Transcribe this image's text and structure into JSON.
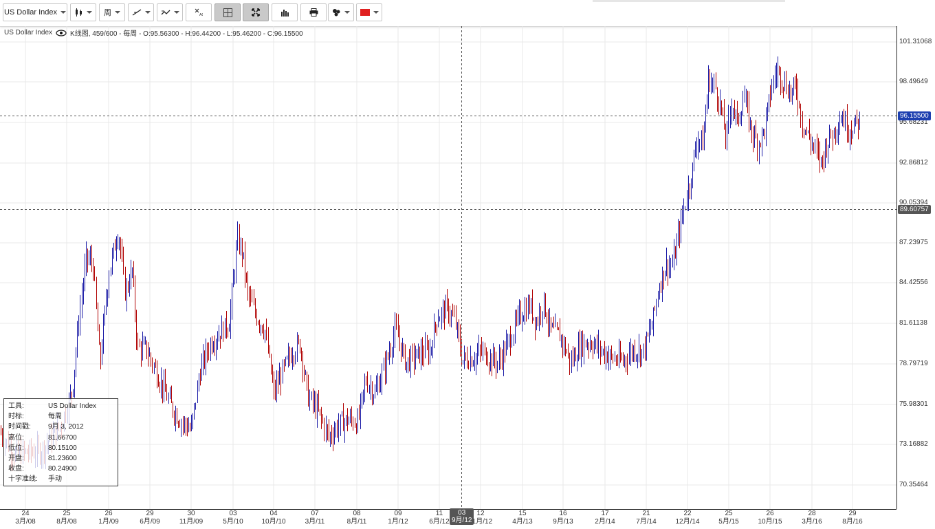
{
  "toolbar": {
    "symbol_select": {
      "value": "US Dollar Index",
      "icon": "chevron-down-icon"
    },
    "chart_style_icon": "candlestick-icon",
    "period_select": {
      "value": "周"
    },
    "indicator_icon": "trend-line-icon",
    "compare_icon": "compare-icon",
    "crosshair_icon": "crosshair-cursor-icon",
    "grid_icon": "grid-toggle-icon",
    "fit_icon": "fit-screen-icon",
    "volume_icon": "volume-bars-icon",
    "print_icon": "print-icon",
    "tools_icon": "drawing-tools-icon",
    "color_icon": "color-swatch-icon",
    "color_swatch": "#e02020"
  },
  "legend": {
    "symbol": "US Dollar Index",
    "eye_icon": "eye-icon",
    "details": "K线图, 459/600 - 每周 - O:95.56300 - H:96.44200 - L:95.46200 - C:96.15500"
  },
  "price_axis": {
    "ticks": [
      "101.31068",
      "98.49649",
      "95.68231",
      "92.86812",
      "90.05394",
      "87.23975",
      "84.42556",
      "81.61138",
      "78.79719",
      "75.98301",
      "73.16882",
      "70.35464"
    ],
    "last_price_tag": "96.15500",
    "crosshair_price_tag": "89.60757",
    "last_price_color": "#1c3fb0",
    "crosshair_tag_color": "#555555"
  },
  "time_axis": {
    "labels": [
      {
        "day": "24",
        "month": "3月/08"
      },
      {
        "day": "25",
        "month": "8月/08"
      },
      {
        "day": "26",
        "month": "1月/09"
      },
      {
        "day": "29",
        "month": "6月/09"
      },
      {
        "day": "30",
        "month": "11月/09"
      },
      {
        "day": "03",
        "month": "5月/10"
      },
      {
        "day": "04",
        "month": "10月/10"
      },
      {
        "day": "07",
        "month": "3月/11"
      },
      {
        "day": "08",
        "month": "8月/11"
      },
      {
        "day": "09",
        "month": "1月/12"
      },
      {
        "day": "11",
        "month": "6月/12"
      },
      {
        "day": "12",
        "month": "11月/12"
      },
      {
        "day": "15",
        "month": "4月/13"
      },
      {
        "day": "16",
        "month": "9月/13"
      },
      {
        "day": "17",
        "month": "2月/14"
      },
      {
        "day": "21",
        "month": "7月/14"
      },
      {
        "day": "22",
        "month": "12月/14"
      },
      {
        "day": "25",
        "month": "5月/15"
      },
      {
        "day": "26",
        "month": "10月/15"
      },
      {
        "day": "28",
        "month": "3月/16"
      },
      {
        "day": "29",
        "month": "8月/16"
      }
    ],
    "crosshair_tag": {
      "day": "03",
      "month": "9月/12"
    }
  },
  "tooltip": {
    "rows": [
      {
        "k": "工具:",
        "v": "US Dollar Index"
      },
      {
        "k": "时标:",
        "v": "每周"
      },
      {
        "k": "时间戳:",
        "v": "9月 3, 2012"
      },
      {
        "k": "高位:",
        "v": "81.66700"
      },
      {
        "k": "低位:",
        "v": "80.15100"
      },
      {
        "k": "开盘:",
        "v": "81.23600"
      },
      {
        "k": "收盘:",
        "v": "80.24900"
      },
      {
        "k": "十字准线:",
        "v": "手动"
      }
    ]
  },
  "colors": {
    "up": "#1a1aa6",
    "down": "#b00000",
    "grid": "#e8e8e8"
  },
  "chart_data": {
    "type": "candlestick",
    "title": "",
    "xlabel": "",
    "ylabel": "",
    "ylim": [
      68.95,
      102.72
    ],
    "x": [
      "3月/08",
      "8月/08",
      "1月/09",
      "6月/09",
      "11月/09",
      "5月/10",
      "10月/10",
      "3月/11",
      "8月/11",
      "1月/12",
      "6月/12",
      "11月/12",
      "4月/13",
      "9月/13",
      "2月/14",
      "7月/14",
      "12月/14",
      "5月/15",
      "10月/15",
      "3月/16",
      "8月/16"
    ],
    "close": [
      72.5,
      76.2,
      86.4,
      79.2,
      75.1,
      87.9,
      78.5,
      75.5,
      74.0,
      79.5,
      82.4,
      79.5,
      82.3,
      79.6,
      80.2,
      80.4,
      90.0,
      96.5,
      98.3,
      95.0,
      95.8
    ],
    "last": {
      "open": 95.563,
      "high": 96.442,
      "low": 95.462,
      "close": 96.155
    }
  }
}
